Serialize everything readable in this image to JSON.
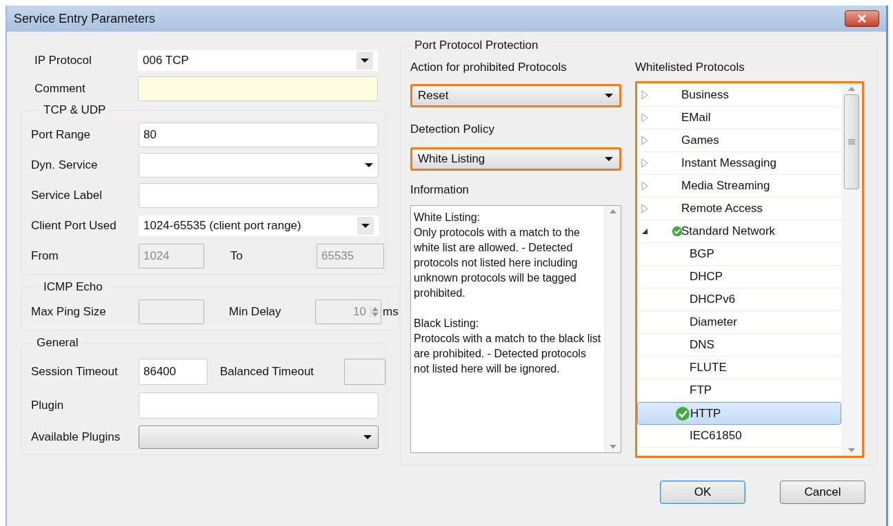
{
  "window": {
    "title": "Service Entry Parameters"
  },
  "ip_protocol": {
    "label": "IP Protocol",
    "value": "006 TCP"
  },
  "comment": {
    "label": "Comment",
    "highlighted": true
  },
  "tcp_udp": {
    "title": "TCP & UDP",
    "port_range": {
      "label": "Port Range",
      "value": "80"
    },
    "dyn_service": {
      "label": "Dyn. Service"
    },
    "service_label": {
      "label": "Service Label"
    },
    "client_port": {
      "label": "Client Port Used",
      "value": "1024-65535 (client port range)"
    },
    "from": {
      "label": "From",
      "value": "1024",
      "disabled": true
    },
    "to": {
      "label": "To",
      "value": "65535",
      "disabled": true
    }
  },
  "icmp_echo": {
    "title": "ICMP Echo",
    "max_ping_size": {
      "label": "Max Ping Size",
      "disabled": true
    },
    "min_delay": {
      "label": "Min Delay",
      "value": "10",
      "unit": "ms",
      "disabled": true
    }
  },
  "general": {
    "title": "General",
    "session_timeout": {
      "label": "Session Timeout",
      "value": "86400"
    },
    "balanced_timeout": {
      "label": "Balanced Timeout",
      "disabled": true
    },
    "plugin": {
      "label": "Plugin"
    },
    "available_plugins": {
      "label": "Available Plugins"
    }
  },
  "protection": {
    "title": "Port Protocol Protection",
    "action": {
      "label": "Action for prohibited Protocols",
      "value": "Reset",
      "highlighted": true
    },
    "detection": {
      "label": "Detection Policy",
      "value": "White Listing",
      "highlighted": true
    },
    "information": {
      "label": "Information",
      "paragraphs": [
        "White Listing:\nOnly protocols with a match to the white list are allowed. - Detected protocols not listed here including unknown protocols will be tagged prohibited.",
        "Black Listing:\nProtocols with a match to the black list are prohibited. - Detected protocols not listed here will be ignored."
      ]
    },
    "whitelist": {
      "label": "Whitelisted Protocols",
      "highlighted": true,
      "items": [
        {
          "label": "Business",
          "expanded": false,
          "checked": false
        },
        {
          "label": "EMail",
          "expanded": false,
          "checked": false
        },
        {
          "label": "Games",
          "expanded": false,
          "checked": false
        },
        {
          "label": "Instant Messaging",
          "expanded": false,
          "checked": false
        },
        {
          "label": "Media Streaming",
          "expanded": false,
          "checked": false
        },
        {
          "label": "Remote Access",
          "expanded": false,
          "checked": false
        },
        {
          "label": "Standard Network",
          "expanded": true,
          "checked": true,
          "children": [
            {
              "label": "BGP",
              "checked": false,
              "selected": false
            },
            {
              "label": "DHCP",
              "checked": false,
              "selected": false
            },
            {
              "label": "DHCPv6",
              "checked": false,
              "selected": false
            },
            {
              "label": "Diameter",
              "checked": false,
              "selected": false
            },
            {
              "label": "DNS",
              "checked": false,
              "selected": false
            },
            {
              "label": "FLUTE",
              "checked": false,
              "selected": false
            },
            {
              "label": "FTP",
              "checked": false,
              "selected": false
            },
            {
              "label": "HTTP",
              "checked": true,
              "selected": true
            },
            {
              "label": "IEC61850",
              "checked": false,
              "selected": false
            }
          ]
        }
      ]
    }
  },
  "buttons": [
    {
      "label": "OK",
      "default": true
    },
    {
      "label": "Cancel",
      "default": false
    }
  ]
}
